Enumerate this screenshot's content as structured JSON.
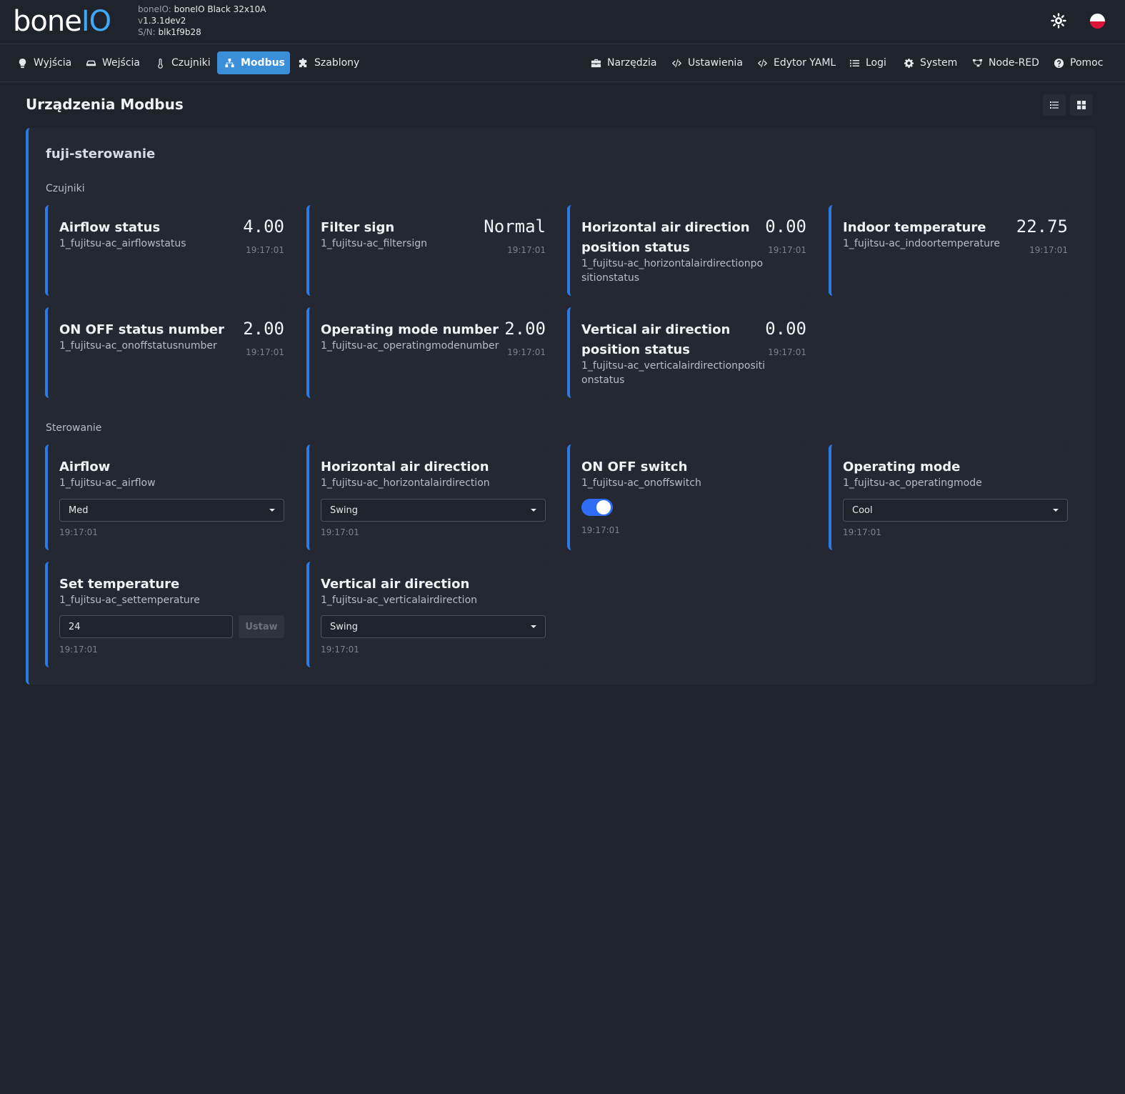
{
  "header": {
    "logo_text_a": "bone",
    "logo_text_b": "IO",
    "device_label": "boneIO:",
    "device_name": "boneIO Black 32x10A",
    "version_prefix": "v",
    "version": "1.3.1dev2",
    "serial_label": "S/N:",
    "serial": "blk1f9b28"
  },
  "nav": {
    "left": [
      {
        "label": "Wyjścia",
        "icon": "bulb-icon"
      },
      {
        "label": "Wejścia",
        "icon": "input-icon"
      },
      {
        "label": "Czujniki",
        "icon": "thermometer-icon"
      },
      {
        "label": "Modbus",
        "icon": "network-icon",
        "active": true
      },
      {
        "label": "Szablony",
        "icon": "puzzle-icon"
      }
    ],
    "right": [
      {
        "label": "Narzędzia",
        "icon": "toolbox-icon"
      },
      {
        "label": "Ustawienia",
        "icon": "code-icon"
      },
      {
        "label": "Edytor YAML",
        "icon": "code-icon"
      },
      {
        "label": "Logi",
        "icon": "list-icon"
      },
      {
        "label": "System",
        "icon": "gear-icon"
      },
      {
        "label": "Node-RED",
        "icon": "nodes-icon"
      },
      {
        "label": "Pomoc",
        "icon": "help-icon"
      }
    ]
  },
  "page": {
    "title": "Urządzenia Modbus"
  },
  "device": {
    "name": "fuji-sterowanie",
    "sensors_label": "Czujniki",
    "controls_label": "Sterowanie",
    "sensors": [
      {
        "name": "Airflow status",
        "id": "1_fujitsu-ac_airflowstatus",
        "value": "4.00",
        "time": "19:17:01"
      },
      {
        "name": "Filter sign",
        "id": "1_fujitsu-ac_filtersign",
        "value": "Normal",
        "time": "19:17:01"
      },
      {
        "name": "Horizontal air direction position status",
        "id": "1_fujitsu-ac_horizontalairdirectionpositionstatus",
        "value": "0.00",
        "time": "19:17:01"
      },
      {
        "name": "Indoor temperature",
        "id": "1_fujitsu-ac_indoortemperature",
        "value": "22.75",
        "time": "19:17:01"
      },
      {
        "name": "ON OFF status number",
        "id": "1_fujitsu-ac_onoffstatusnumber",
        "value": "2.00",
        "time": "19:17:01"
      },
      {
        "name": "Operating mode number",
        "id": "1_fujitsu-ac_operatingmodenumber",
        "value": "2.00",
        "time": "19:17:01"
      },
      {
        "name": "Vertical air direction position status",
        "id": "1_fujitsu-ac_verticalairdirectionpositionstatus",
        "value": "0.00",
        "time": "19:17:01"
      }
    ],
    "controls": [
      {
        "name": "Airflow",
        "id": "1_fujitsu-ac_airflow",
        "type": "select",
        "value": "Med",
        "time": "19:17:01"
      },
      {
        "name": "Horizontal air direction",
        "id": "1_fujitsu-ac_horizontalairdirection",
        "type": "select",
        "value": "Swing",
        "time": "19:17:01"
      },
      {
        "name": "ON OFF switch",
        "id": "1_fujitsu-ac_onoffswitch",
        "type": "switch",
        "value": "on",
        "time": "19:17:01"
      },
      {
        "name": "Operating mode",
        "id": "1_fujitsu-ac_operatingmode",
        "type": "select",
        "value": "Cool",
        "time": "19:17:01"
      },
      {
        "name": "Set temperature",
        "id": "1_fujitsu-ac_settemperature",
        "type": "number",
        "value": "24",
        "button": "Ustaw",
        "time": "19:17:01"
      },
      {
        "name": "Vertical air direction",
        "id": "1_fujitsu-ac_verticalairdirection",
        "type": "select",
        "value": "Swing",
        "time": "19:17:01"
      }
    ]
  }
}
